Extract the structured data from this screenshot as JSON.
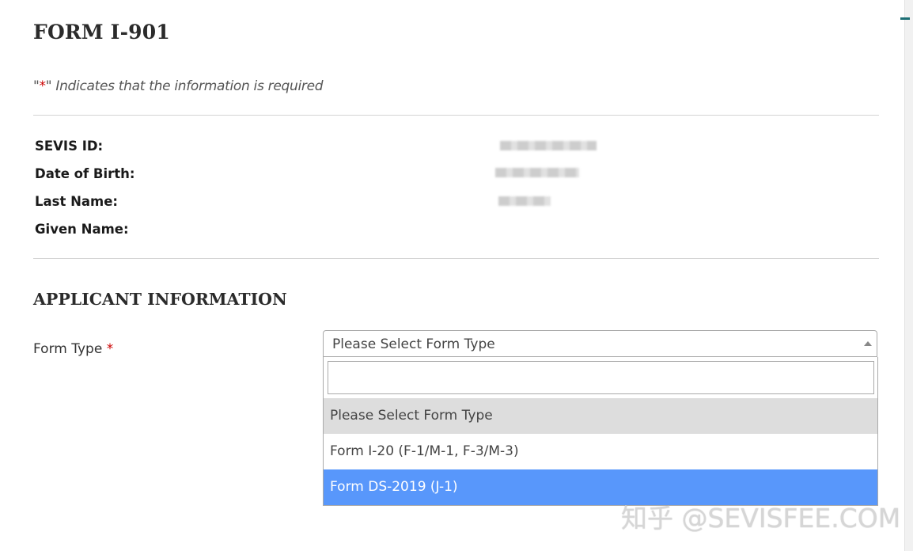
{
  "page": {
    "title": "FORM I-901",
    "required_note_prefix": "\"",
    "required_note_star": "*",
    "required_note_suffix": "\" Indicates that the information is required"
  },
  "applicant_summary": {
    "labels": [
      "SEVIS ID:",
      "Date of Birth:",
      "Last Name:",
      "Given Name:"
    ]
  },
  "applicant_information": {
    "section_title": "APPLICANT INFORMATION",
    "form_type": {
      "label": "Form Type",
      "required_marker": "*",
      "selected_value": "Please Select Form Type",
      "search_value": "",
      "options": [
        "Please Select Form Type",
        "Form I-20 (F-1/M-1, F-3/M-3)",
        "Form DS-2019 (J-1)"
      ]
    }
  },
  "watermark": "知乎 @SEVISFEE.COM",
  "colors": {
    "required_star": "#cc0000",
    "option_highlight": "#5897fb",
    "option_selected_bg": "#dddddd"
  }
}
